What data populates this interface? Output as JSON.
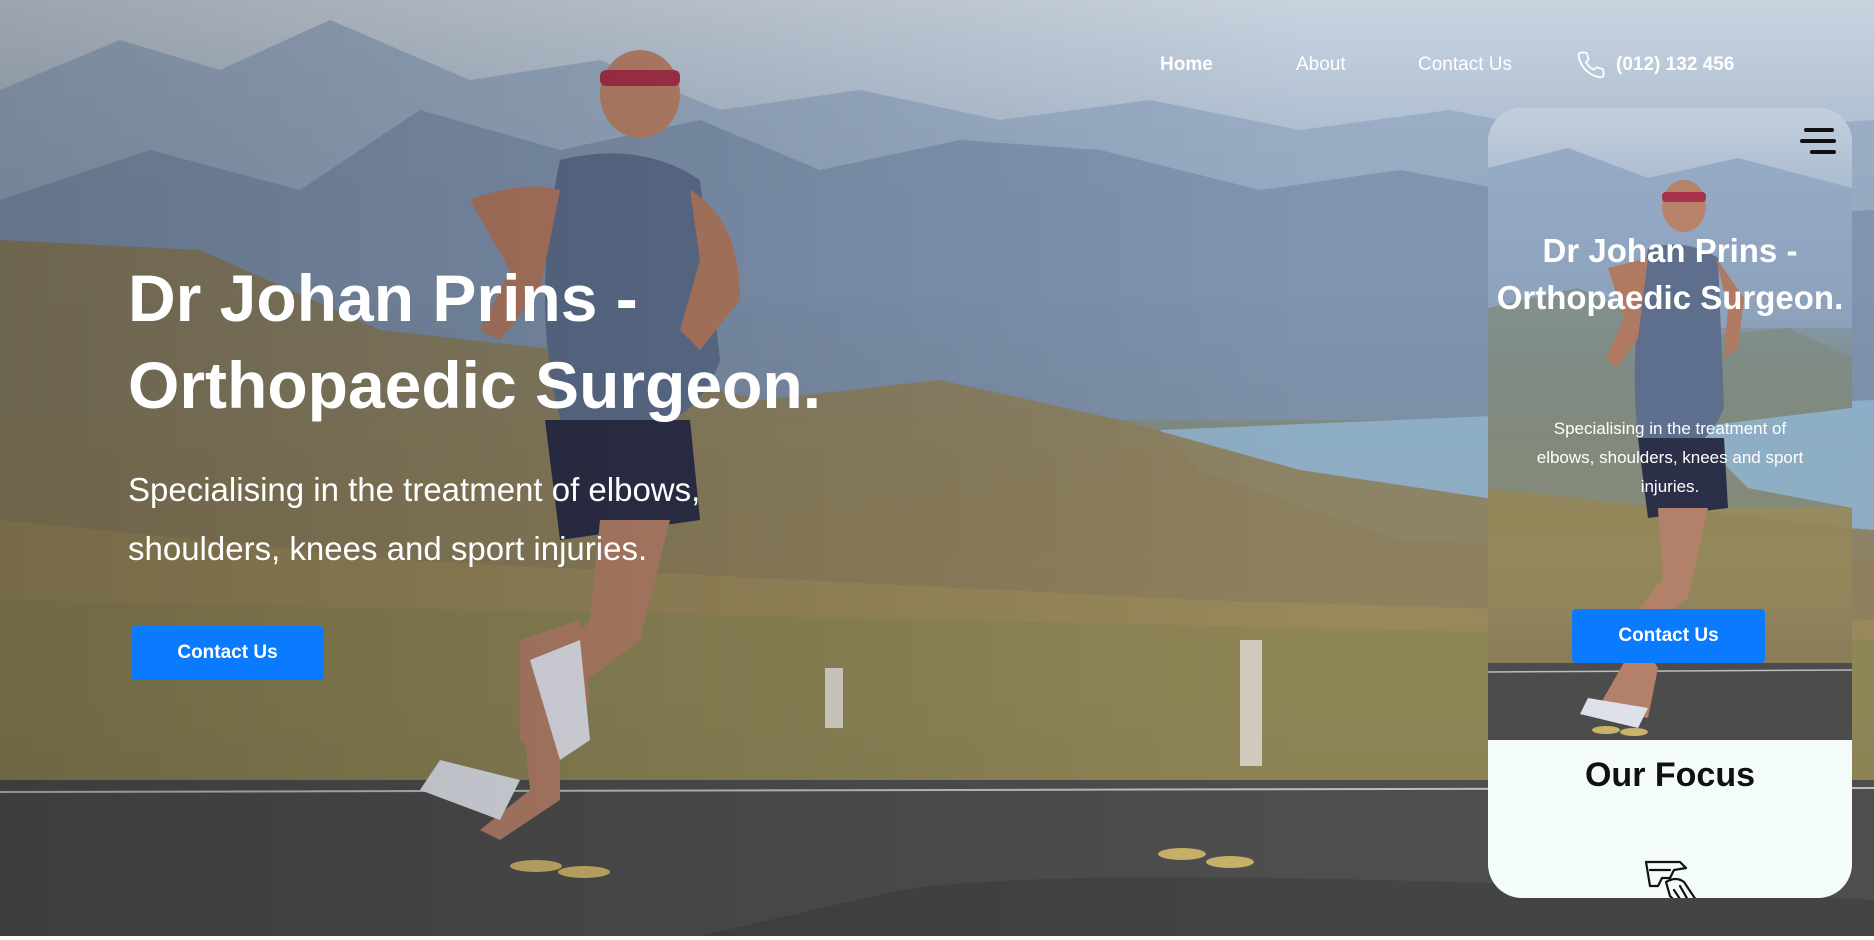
{
  "nav": {
    "home": "Home",
    "about": "About",
    "contact": "Contact Us",
    "phone": "(012) 132 456"
  },
  "hero": {
    "title_bold": "Dr Johan Prins -",
    "title_light": "Orthopaedic Surgeon.",
    "subtitle": "Specialising in the treatment of elbows, shoulders, knees and sport injuries.",
    "cta": "Contact Us"
  },
  "mobile": {
    "title_bold": "Dr Johan Prins -",
    "title_light": "Orthopaedic Surgeon.",
    "subtitle": "Specialising in the treatment of elbows, shoulders, knees and sport injuries.",
    "cta": "Contact Us",
    "section_title": "Our Focus",
    "menu_icon": "hamburger-menu-icon",
    "focus_icon": "elbow-joint-icon"
  },
  "colors": {
    "accent": "#0a7bff",
    "text_on_hero": "#ffffff",
    "section_bg": "#f4fbfb"
  }
}
